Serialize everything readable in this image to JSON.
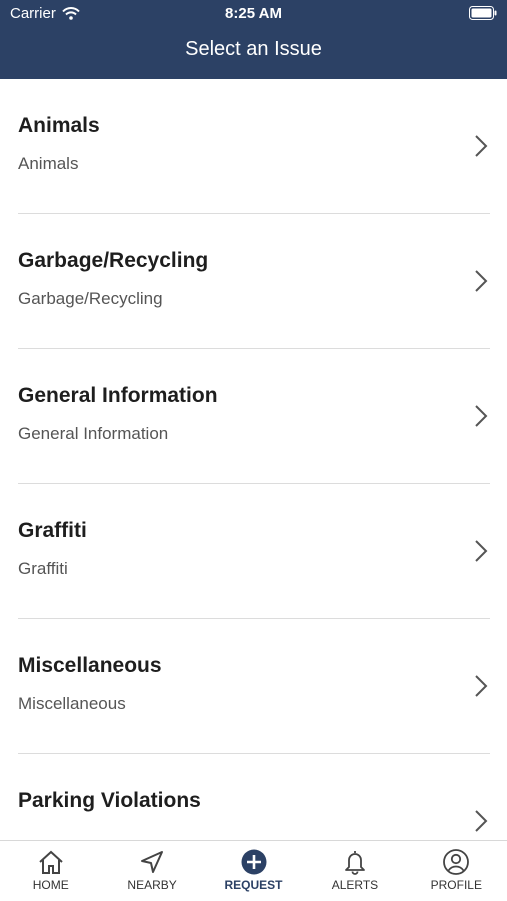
{
  "status_bar": {
    "carrier": "Carrier",
    "time": "8:25 AM"
  },
  "header": {
    "title": "Select an Issue"
  },
  "issues": [
    {
      "name": "Animals",
      "subtitle": "Animals"
    },
    {
      "name": "Garbage/Recycling",
      "subtitle": "Garbage/Recycling"
    },
    {
      "name": "General Information",
      "subtitle": "General Information"
    },
    {
      "name": "Graffiti",
      "subtitle": "Graffiti"
    },
    {
      "name": "Miscellaneous",
      "subtitle": "Miscellaneous"
    },
    {
      "name": "Parking Violations",
      "subtitle": ""
    }
  ],
  "tabbar": {
    "items": [
      {
        "label": "HOME",
        "icon": "home-icon"
      },
      {
        "label": "NEARBY",
        "icon": "location-arrow-icon"
      },
      {
        "label": "REQUEST",
        "icon": "plus-circle-icon",
        "active": true
      },
      {
        "label": "ALERTS",
        "icon": "bell-icon"
      },
      {
        "label": "PROFILE",
        "icon": "user-circle-icon"
      }
    ]
  },
  "colors": {
    "header_bg": "#2c4165",
    "accent": "#2c4165",
    "divider": "#dcdcdc"
  }
}
